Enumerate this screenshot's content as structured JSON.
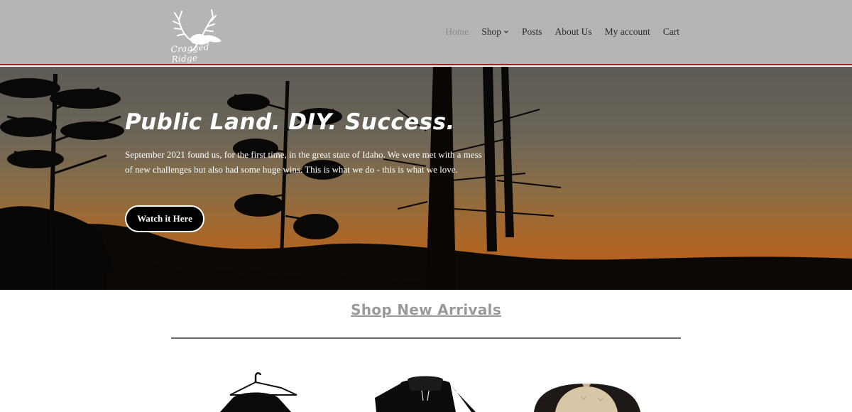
{
  "header": {
    "logo_text": "Cragged Ridge",
    "nav": [
      {
        "label": "Home",
        "active": true
      },
      {
        "label": "Shop",
        "has_dropdown": true
      },
      {
        "label": "Posts"
      },
      {
        "label": "About Us"
      },
      {
        "label": "My account"
      },
      {
        "label": "Cart"
      }
    ]
  },
  "hero": {
    "title": "Public Land. DIY. Success.",
    "text": "September 2021 found us, for the first time, in the great state of Idaho. We were met with a mess of new challenges but also had some huge wins. This is what we do - this is what we love.",
    "button_label": "Watch it Here"
  },
  "shop": {
    "title": "Shop New Arrivals",
    "products": [
      {
        "name": "black shirt on hanger"
      },
      {
        "name": "black hoodie"
      },
      {
        "name": "tan and brown trucker hat"
      }
    ]
  },
  "colors": {
    "header_bg": "#b5b5b5",
    "header_border": "#a31d1d",
    "button_bg": "#000000",
    "section_title": "#9a9a9a"
  }
}
